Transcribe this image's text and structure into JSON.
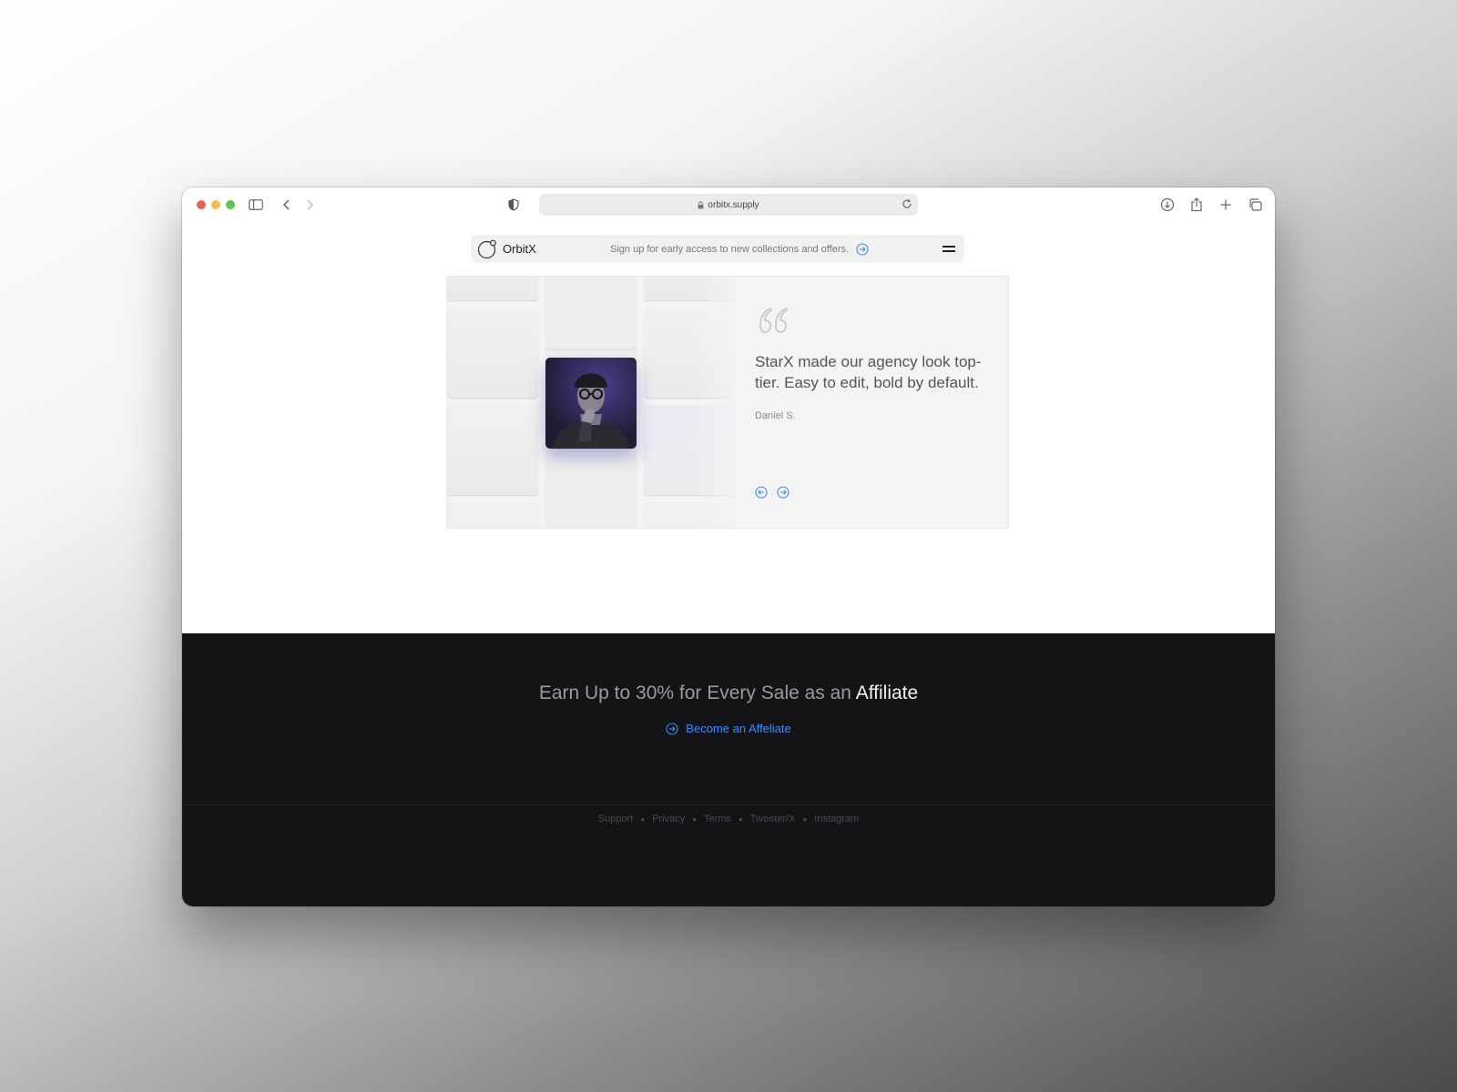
{
  "browser": {
    "url": "orbitx.supply",
    "icons": [
      "sidebar-icon",
      "back-icon",
      "forward-icon",
      "shield-icon",
      "lock-icon",
      "reload-icon",
      "download-icon",
      "share-icon",
      "plus-icon",
      "tabs-icon"
    ]
  },
  "topbar": {
    "brand": "OrbitX",
    "promo": "Sign up for early access to new collections and offers."
  },
  "testimonial": {
    "quote": "StarX made our agency look top-tier. Easy to edit, bold by default.",
    "author": "Daniel S."
  },
  "affiliate": {
    "title_prefix": "Earn Up to 30% for Every Sale as an",
    "title_highlight": "Affiliate",
    "cta": "Become an Affeliate"
  },
  "footer": {
    "links": [
      "Support",
      "Privacy",
      "Terms",
      "Tweeter/X",
      "Instagram"
    ]
  },
  "colors": {
    "accent": "#3d8bff",
    "dark_bg": "#141416"
  }
}
